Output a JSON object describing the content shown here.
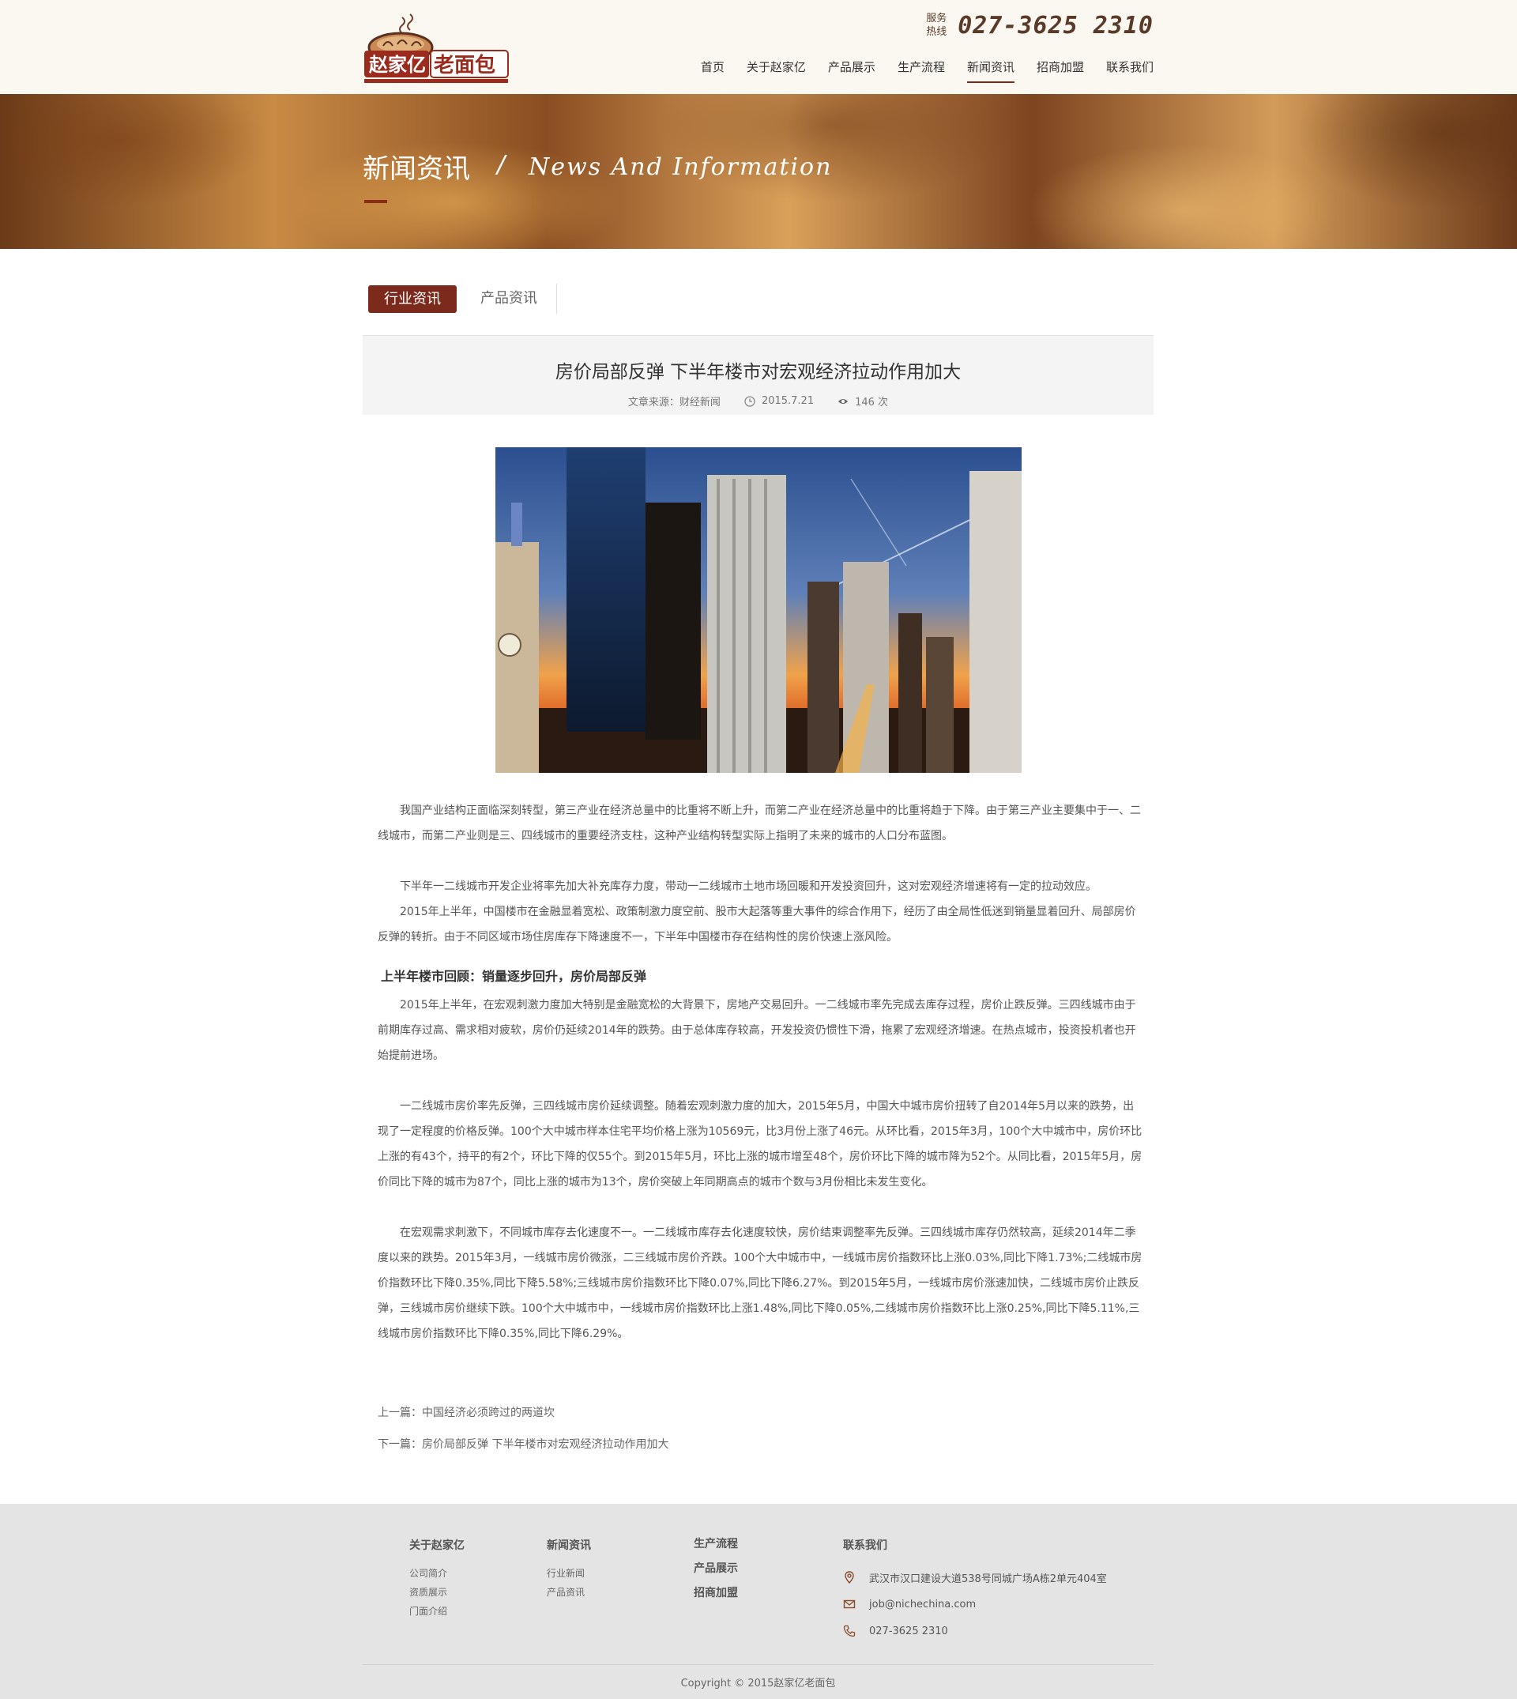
{
  "header": {
    "logo_text": "赵家亿老面包",
    "hotline_label": "服务热线",
    "hotline_number": "027-3625  2310",
    "nav": [
      {
        "label": "首页",
        "active": false
      },
      {
        "label": "关于赵家亿",
        "active": false
      },
      {
        "label": "产品展示",
        "active": false
      },
      {
        "label": "生产流程",
        "active": false
      },
      {
        "label": "新闻资讯",
        "active": true
      },
      {
        "label": "招商加盟",
        "active": false
      },
      {
        "label": "联系我们",
        "active": false
      }
    ]
  },
  "banner": {
    "title": "新闻资讯",
    "slash": "/",
    "title_en": "News And Information"
  },
  "tabs": [
    {
      "label": "行业资讯",
      "active": true
    },
    {
      "label": "产品资讯",
      "active": false
    }
  ],
  "article": {
    "title": "房价局部反弹 下半年楼市对宏观经济拉动作用加大",
    "source": "文章来源：财经新闻",
    "date": "2015.7.21",
    "views": "146 次",
    "paragraphs": [
      "我国产业结构正面临深刻转型，第三产业在经济总量中的比重将不断上升，而第二产业在经济总量中的比重将趋于下降。由于第三产业主要集中于一、二线城市，而第二产业则是三、四线城市的重要经济支柱，这种产业结构转型实际上指明了未来的城市的人口分布蓝图。",
      "下半年一二线城市开发企业将率先加大补充库存力度，带动一二线城市土地市场回暖和开发投资回升，这对宏观经济增速将有一定的拉动效应。",
      "2015年上半年，中国楼市在金融显着宽松、政策制激力度空前、股市大起落等重大事件的综合作用下，经历了由全局性低迷到销量显着回升、局部房价反弹的转折。由于不同区域市场住房库存下降速度不一，下半年中国楼市存在结构性的房价快速上涨风险。"
    ],
    "subheading": "上半年楼市回顾：销量逐步回升，房价局部反弹",
    "paragraphs2": [
      "2015年上半年，在宏观刺激力度加大特别是金融宽松的大背景下，房地产交易回升。一二线城市率先完成去库存过程，房价止跌反弹。三四线城市由于前期库存过高、需求相对疲软，房价仍延续2014年的跌势。由于总体库存较高，开发投资仍惯性下滑，拖累了宏观经济增速。在热点城市，投资投机者也开始提前进场。",
      "一二线城市房价率先反弹，三四线城市房价延续调整。随着宏观刺激力度的加大，2015年5月，中国大中城市房价扭转了自2014年5月以来的跌势，出现了一定程度的价格反弹。100个大中城市样本住宅平均价格上涨为10569元，比3月份上涨了46元。从环比看，2015年3月，100个大中城市中，房价环比上涨的有43个，持平的有2个，环比下降的仅55个。到2015年5月，环比上涨的城市增至48个，房价环比下降的城市降为52个。从同比看，2015年5月，房价同比下降的城市为87个，同比上涨的城市为13个，房价突破上年同期高点的城市个数与3月份相比未发生变化。",
      "在宏观需求刺激下，不同城市库存去化速度不一。一二线城市库存去化速度较快，房价结束调整率先反弹。三四线城市库存仍然较高，延续2014年二季度以来的跌势。2015年3月，一线城市房价微涨，二三线城市房价齐跌。100个大中城市中，一线城市房价指数环比上涨0.03%,同比下降1.73%;二线城市房价指数环比下降0.35%,同比下降5.58%;三线城市房价指数环比下降0.07%,同比下降6.27%。到2015年5月，一线城市房价涨速加快，二线城市房价止跌反弹，三线城市房价继续下跌。100个大中城市中，一线城市房价指数环比上涨1.48%,同比下降0.05%,二线城市房价指数环比上涨0.25%,同比下降5.11%,三线城市房价指数环比下降0.35%,同比下降6.29%。"
    ],
    "prev_label": "上一篇：中国经济必须跨过的两道坎",
    "next_label": "下一篇：房价局部反弹   下半年楼市对宏观经济拉动作用加大"
  },
  "footer": {
    "col1": {
      "title": "关于赵家亿",
      "links": [
        "公司简介",
        "资质展示",
        "门面介绍"
      ]
    },
    "col2": {
      "title": "新闻资讯",
      "links": [
        "行业新闻",
        "产品资讯"
      ]
    },
    "col3": {
      "links": [
        "生产流程",
        "产品展示",
        "招商加盟"
      ]
    },
    "col4": {
      "title": "联系我们",
      "address": "武汉市汉口建设大道538号同城广场A栋2单元404室",
      "email": "job@nichechina.com",
      "phone": "027-3625 2310"
    },
    "copyright": "Copyright  ©  2015赵家亿老面包"
  },
  "colors": {
    "brand": "#7b2a1c",
    "header_bg": "#fbf8f1",
    "footer_bg": "#e4e4e4"
  },
  "icons": {
    "clock": "clock-icon",
    "eye": "eye-icon",
    "location": "location-icon",
    "mail": "mail-icon",
    "phone": "phone-icon"
  }
}
